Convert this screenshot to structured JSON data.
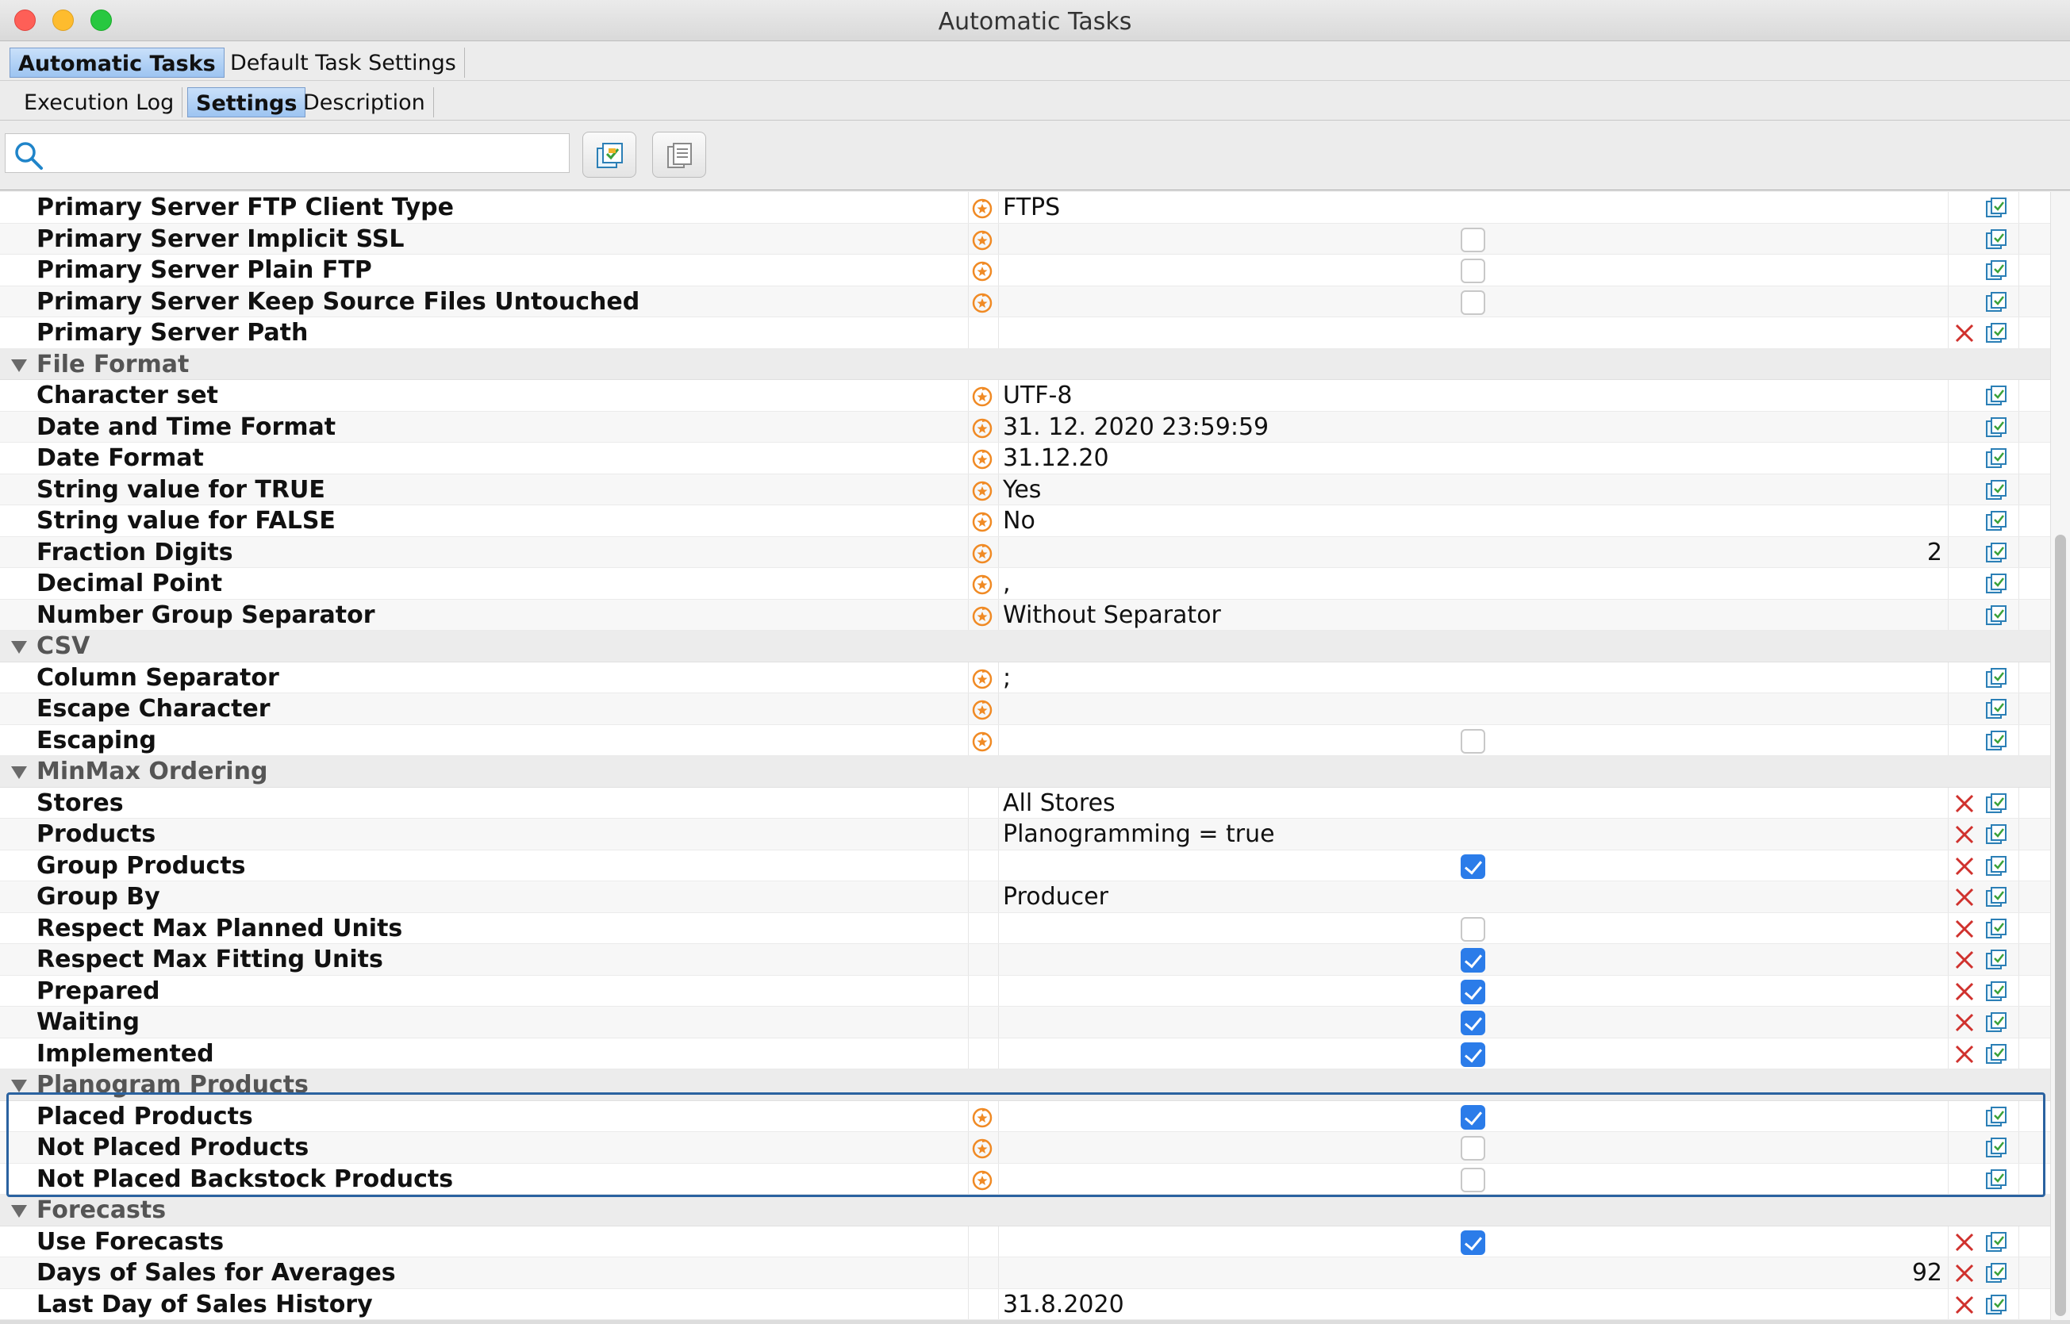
{
  "window": {
    "title": "Automatic Tasks"
  },
  "tabs_top": [
    {
      "label": "Automatic Tasks",
      "active": true
    },
    {
      "label": "Default Task Settings",
      "active": false
    }
  ],
  "tabs_sub": [
    {
      "label": "Execution Log",
      "active": false
    },
    {
      "label": "Settings",
      "active": true
    },
    {
      "label": "Description",
      "active": false
    }
  ],
  "search": {
    "placeholder": "",
    "value": ""
  },
  "toolbar": {
    "icons": [
      "copy-settings-icon",
      "paste-settings-icon"
    ]
  },
  "colors": {
    "accent": "#2b7ce9",
    "delete": "#d0312d",
    "reset": "#f08a24",
    "highlight": "#2a62a0"
  },
  "rows": [
    {
      "kind": "row",
      "name": "Primary Server FTP Client Type",
      "reset": true,
      "value": "FTPS"
    },
    {
      "kind": "row",
      "name": "Primary Server Implicit SSL",
      "reset": true,
      "checkbox": false
    },
    {
      "kind": "row",
      "name": "Primary Server Plain FTP",
      "reset": true,
      "checkbox": false
    },
    {
      "kind": "row",
      "name": "Primary Server Keep Source Files Untouched",
      "reset": true,
      "checkbox": false
    },
    {
      "kind": "row",
      "name": "Primary Server Path",
      "reset": false,
      "value": "",
      "delete": true
    },
    {
      "kind": "group",
      "name": "File Format"
    },
    {
      "kind": "row",
      "name": "Character set",
      "reset": true,
      "value": "UTF-8"
    },
    {
      "kind": "row",
      "name": "Date and Time Format",
      "reset": true,
      "value": "31. 12. 2020 23:59:59"
    },
    {
      "kind": "row",
      "name": "Date Format",
      "reset": true,
      "value": "31.12.20"
    },
    {
      "kind": "row",
      "name": "String value for TRUE",
      "reset": true,
      "value": "Yes"
    },
    {
      "kind": "row",
      "name": "String value for FALSE",
      "reset": true,
      "value": "No"
    },
    {
      "kind": "row",
      "name": "Fraction Digits",
      "reset": true,
      "number": "2"
    },
    {
      "kind": "row",
      "name": "Decimal Point",
      "reset": true,
      "value": ","
    },
    {
      "kind": "row",
      "name": "Number Group Separator",
      "reset": true,
      "value": "Without Separator"
    },
    {
      "kind": "group",
      "name": "CSV"
    },
    {
      "kind": "row",
      "name": "Column Separator",
      "reset": true,
      "value": ";"
    },
    {
      "kind": "row",
      "name": "Escape Character",
      "reset": true,
      "value": ""
    },
    {
      "kind": "row",
      "name": "Escaping",
      "reset": true,
      "checkbox": false
    },
    {
      "kind": "group",
      "name": "MinMax Ordering"
    },
    {
      "kind": "row",
      "name": "Stores",
      "reset": false,
      "value": "All Stores",
      "delete": true
    },
    {
      "kind": "row",
      "name": "Products",
      "reset": false,
      "value": "Planogramming = true",
      "delete": true
    },
    {
      "kind": "row",
      "name": "Group Products",
      "reset": false,
      "checkbox": true,
      "delete": true
    },
    {
      "kind": "row",
      "name": "Group By",
      "reset": false,
      "value": "Producer",
      "delete": true
    },
    {
      "kind": "row",
      "name": "Respect Max Planned Units",
      "reset": false,
      "checkbox": false,
      "delete": true
    },
    {
      "kind": "row",
      "name": "Respect Max Fitting Units",
      "reset": false,
      "checkbox": true,
      "delete": true
    },
    {
      "kind": "row",
      "name": "Prepared",
      "reset": false,
      "checkbox": true,
      "delete": true
    },
    {
      "kind": "row",
      "name": "Waiting",
      "reset": false,
      "checkbox": true,
      "delete": true
    },
    {
      "kind": "row",
      "name": "Implemented",
      "reset": false,
      "checkbox": true,
      "delete": true
    },
    {
      "kind": "group",
      "name": "Planogram Products"
    },
    {
      "kind": "row",
      "name": "Placed Products",
      "reset": true,
      "checkbox": true
    },
    {
      "kind": "row",
      "name": "Not Placed Products",
      "reset": true,
      "checkbox": false
    },
    {
      "kind": "row",
      "name": "Not Placed Backstock Products",
      "reset": true,
      "checkbox": false
    },
    {
      "kind": "group",
      "name": "Forecasts"
    },
    {
      "kind": "row",
      "name": "Use Forecasts",
      "reset": false,
      "checkbox": true,
      "delete": true
    },
    {
      "kind": "row",
      "name": "Days of Sales for Averages",
      "reset": false,
      "number": "92",
      "delete": true
    },
    {
      "kind": "row",
      "name": "Last Day of Sales History",
      "reset": false,
      "value": "31.8.2020",
      "delete": true
    }
  ]
}
